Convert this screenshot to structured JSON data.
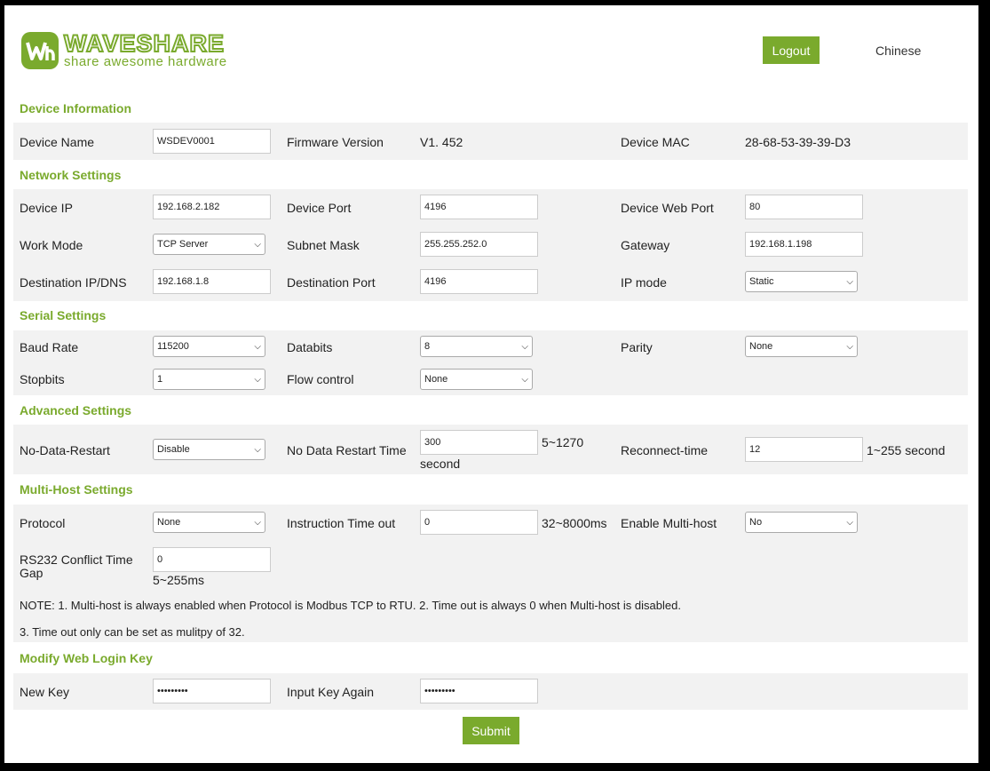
{
  "brand": {
    "name": "WAVESHARE",
    "tagline": "share awesome hardware",
    "color": "#7aaa2d"
  },
  "header": {
    "logout": "Logout",
    "language": "Chinese"
  },
  "sections": {
    "device_info": "Device Information",
    "network": "Network Settings",
    "serial": "Serial Settings",
    "advanced": "Advanced Settings",
    "multihost": "Multi-Host Settings",
    "login_key": "Modify Web Login Key"
  },
  "device_info": {
    "device_name_label": "Device Name",
    "device_name_value": "WSDEV0001",
    "firmware_label": "Firmware Version",
    "firmware_value": "V1. 452",
    "mac_label": "Device MAC",
    "mac_value": "28-68-53-39-39-D3"
  },
  "network": {
    "device_ip_label": "Device IP",
    "device_ip_value": "192.168.2.182",
    "device_port_label": "Device Port",
    "device_port_value": "4196",
    "web_port_label": "Device Web Port",
    "web_port_value": "80",
    "work_mode_label": "Work Mode",
    "work_mode_value": "TCP Server",
    "subnet_label": "Subnet Mask",
    "subnet_value": "255.255.252.0",
    "gateway_label": "Gateway",
    "gateway_value": "192.168.1.198",
    "dest_ip_label": "Destination IP/DNS",
    "dest_ip_value": "192.168.1.8",
    "dest_port_label": "Destination Port",
    "dest_port_value": "4196",
    "ip_mode_label": "IP mode",
    "ip_mode_value": "Static"
  },
  "serial": {
    "baud_label": "Baud Rate",
    "baud_value": "115200",
    "databits_label": "Databits",
    "databits_value": "8",
    "parity_label": "Parity",
    "parity_value": "None",
    "stopbits_label": "Stopbits",
    "stopbits_value": "1",
    "flow_label": "Flow control",
    "flow_value": "None"
  },
  "advanced": {
    "no_data_restart_label": "No-Data-Restart",
    "no_data_restart_value": "Disable",
    "restart_time_label": "No Data Restart Time",
    "restart_time_value": "300",
    "restart_time_hint": "5~1270",
    "restart_time_unit": "second",
    "reconnect_label": "Reconnect-time",
    "reconnect_value": "12",
    "reconnect_hint": "1~255 second"
  },
  "multihost": {
    "protocol_label": "Protocol",
    "protocol_value": "None",
    "timeout_label": "Instruction Time out",
    "timeout_value": "0",
    "timeout_hint": "32~8000ms",
    "enable_label": "Enable Multi-host",
    "enable_value": "No",
    "conflict_label_1": "RS232 Conflict Time",
    "conflict_label_2": "Gap",
    "conflict_value": "0",
    "conflict_hint": "5~255ms",
    "note1": "NOTE: 1. Multi-host is always enabled when Protocol is Modbus TCP to RTU. 2. Time out is always 0 when Multi-host is disabled.",
    "note2": "3. Time out only can be set as mulitpy of 32."
  },
  "login_key": {
    "new_key_label": "New Key",
    "new_key_value": "•••••••••",
    "again_label": "Input Key Again",
    "again_value": "•••••••••"
  },
  "submit": "Submit"
}
